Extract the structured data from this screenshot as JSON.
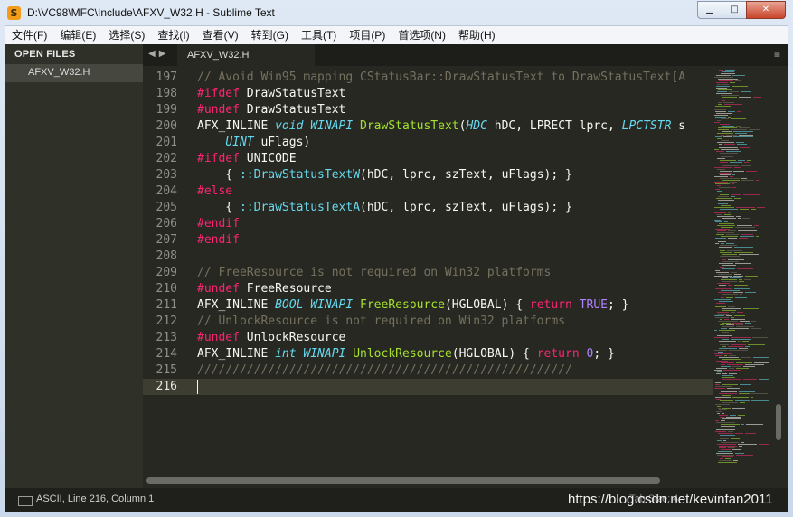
{
  "window": {
    "title": "D:\\VC98\\MFC\\Include\\AFXV_W32.H - Sublime Text",
    "icon": "sublime-text-icon",
    "controls": [
      "minimize",
      "maximize",
      "close"
    ]
  },
  "menu": [
    "文件(F)",
    "编辑(E)",
    "选择(S)",
    "查找(I)",
    "查看(V)",
    "转到(G)",
    "工具(T)",
    "项目(P)",
    "首选项(N)",
    "帮助(H)"
  ],
  "sidebar": {
    "header": "OPEN FILES",
    "files": [
      "AFXV_W32.H"
    ]
  },
  "tabs": [
    {
      "label": "AFXV_W32.H",
      "active": true
    }
  ],
  "tab_nav_icons": [
    "chevron-left-icon",
    "chevron-right-icon",
    "hamburger-menu-icon"
  ],
  "editor": {
    "current_line": 216,
    "lines": [
      {
        "n": "197",
        "tokens": [
          [
            "comment",
            "// Avoid Win95 mapping CStatusBar::DrawStatusText to DrawStatusText[A"
          ]
        ]
      },
      {
        "n": "198",
        "tokens": [
          [
            "kw",
            "#ifdef"
          ],
          [
            "plain",
            " DrawStatusText"
          ]
        ]
      },
      {
        "n": "199",
        "tokens": [
          [
            "kw",
            "#undef"
          ],
          [
            "plain",
            " DrawStatusText"
          ]
        ]
      },
      {
        "n": "200",
        "tokens": [
          [
            "plain",
            "AFX_INLINE "
          ],
          [
            "type",
            "void"
          ],
          [
            "plain",
            " "
          ],
          [
            "type",
            "WINAPI"
          ],
          [
            "plain",
            " "
          ],
          [
            "func",
            "DrawStatusText"
          ],
          [
            "plain",
            "("
          ],
          [
            "type",
            "HDC"
          ],
          [
            "plain",
            " hDC, LPRECT lprc, "
          ],
          [
            "type",
            "LPCTSTR"
          ],
          [
            "plain",
            " s"
          ]
        ]
      },
      {
        "n": "201",
        "tokens": [
          [
            "plain",
            "    "
          ],
          [
            "type",
            "UINT"
          ],
          [
            "plain",
            " uFlags)"
          ]
        ]
      },
      {
        "n": "202",
        "tokens": [
          [
            "kw",
            "#ifdef"
          ],
          [
            "plain",
            " UNICODE"
          ]
        ]
      },
      {
        "n": "203",
        "tokens": [
          [
            "plain",
            "    { "
          ],
          [
            "builtin",
            "::DrawStatusTextW"
          ],
          [
            "plain",
            "(hDC, lprc, szText, uFlags); }"
          ]
        ]
      },
      {
        "n": "204",
        "tokens": [
          [
            "kw",
            "#else"
          ]
        ]
      },
      {
        "n": "205",
        "tokens": [
          [
            "plain",
            "    { "
          ],
          [
            "builtin",
            "::DrawStatusTextA"
          ],
          [
            "plain",
            "(hDC, lprc, szText, uFlags); }"
          ]
        ]
      },
      {
        "n": "206",
        "tokens": [
          [
            "kw",
            "#endif"
          ]
        ]
      },
      {
        "n": "207",
        "tokens": [
          [
            "kw",
            "#endif"
          ]
        ]
      },
      {
        "n": "208",
        "tokens": []
      },
      {
        "n": "209",
        "tokens": [
          [
            "comment",
            "// FreeResource is not required on Win32 platforms"
          ]
        ]
      },
      {
        "n": "210",
        "tokens": [
          [
            "kw",
            "#undef"
          ],
          [
            "plain",
            " FreeResource"
          ]
        ]
      },
      {
        "n": "211",
        "tokens": [
          [
            "plain",
            "AFX_INLINE "
          ],
          [
            "type",
            "BOOL"
          ],
          [
            "plain",
            " "
          ],
          [
            "type",
            "WINAPI"
          ],
          [
            "plain",
            " "
          ],
          [
            "func",
            "FreeResource"
          ],
          [
            "plain",
            "(HGLOBAL) { "
          ],
          [
            "kw",
            "return"
          ],
          [
            "plain",
            " "
          ],
          [
            "num",
            "TRUE"
          ],
          [
            "plain",
            "; }"
          ]
        ]
      },
      {
        "n": "212",
        "tokens": [
          [
            "comment",
            "// UnlockResource is not required on Win32 platforms"
          ]
        ]
      },
      {
        "n": "213",
        "tokens": [
          [
            "kw",
            "#undef"
          ],
          [
            "plain",
            " UnlockResource"
          ]
        ]
      },
      {
        "n": "214",
        "tokens": [
          [
            "plain",
            "AFX_INLINE "
          ],
          [
            "type",
            "int"
          ],
          [
            "plain",
            " "
          ],
          [
            "type",
            "WINAPI"
          ],
          [
            "plain",
            " "
          ],
          [
            "func",
            "UnlockResource"
          ],
          [
            "plain",
            "(HGLOBAL) { "
          ],
          [
            "kw",
            "return"
          ],
          [
            "plain",
            " "
          ],
          [
            "num",
            "0"
          ],
          [
            "plain",
            "; }"
          ]
        ]
      },
      {
        "n": "215",
        "tokens": [
          [
            "comment",
            "/////////////////////////////////////////////////////"
          ]
        ]
      },
      {
        "n": "216",
        "tokens": []
      }
    ]
  },
  "status": {
    "encoding_position": "ASCII, Line 216, Column 1",
    "right": "Tab Size: 4"
  },
  "watermark": "https://blog.csdn.net/kevinfan2011",
  "colors": {
    "background": "#272822",
    "comment": "#75715e",
    "keyword": "#f92672",
    "type": "#66d9ef",
    "function": "#a6e22e",
    "number": "#ae81ff",
    "text": "#f8f8f2"
  }
}
